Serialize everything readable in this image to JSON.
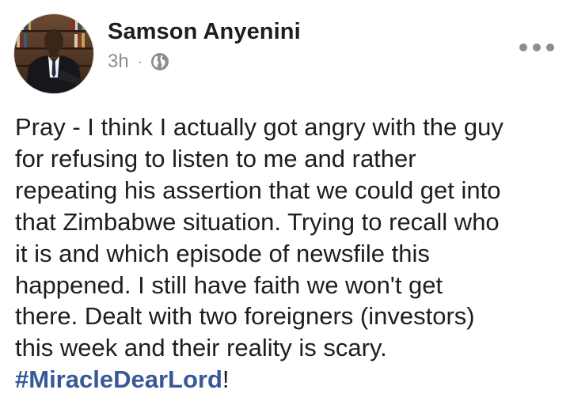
{
  "post": {
    "author_name": "Samson Anyenini",
    "timestamp": "3h",
    "separator": "·",
    "privacy_icon": "globe-icon",
    "more_icon": "more-options-icon",
    "avatar_icon": "profile-photo",
    "body_lines": [
      "Pray - I think I actually got angry with the guy",
      "for refusing to listen to me and rather",
      "repeating his assertion that we could get into",
      "that Zimbabwe situation. Trying to recall who",
      "it is and which episode of newsfile this",
      "happened. I still have faith we won't get",
      "there. Dealt with two foreigners (investors)",
      "this week and their reality is scary."
    ],
    "hashtag": "#MiracleDearLord",
    "hashtag_suffix": "!"
  },
  "colors": {
    "text": "#1c1e21",
    "secondary_text": "#8a8d91",
    "hashtag": "#385898",
    "background": "#ffffff"
  }
}
